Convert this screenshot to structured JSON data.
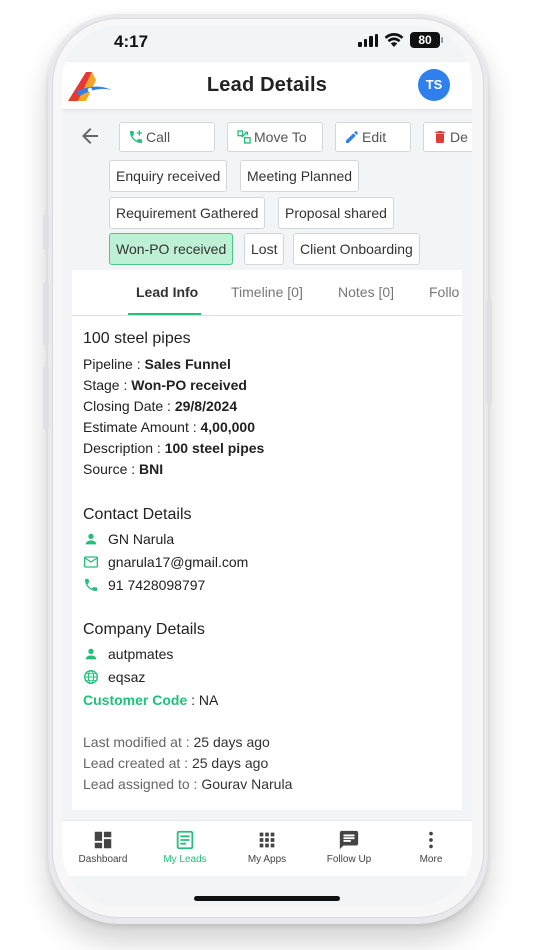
{
  "status_bar": {
    "time": "4:17",
    "battery": "80"
  },
  "app_bar": {
    "title": "Lead Details",
    "avatar_initials": "TS"
  },
  "actions": {
    "call": "Call",
    "move_to": "Move To",
    "edit": "Edit",
    "delete": "De"
  },
  "stages": {
    "enquiry": "Enquiry received",
    "meeting": "Meeting Planned",
    "requirement": "Requirement Gathered",
    "proposal": "Proposal shared",
    "won": "Won-PO received",
    "lost": "Lost",
    "onboarding": "Client Onboarding",
    "active": "Won-PO received"
  },
  "tabs": {
    "lead_info": "Lead Info",
    "timeline": "Timeline [0]",
    "notes": "Notes [0]",
    "follow": "Follo"
  },
  "lead": {
    "title": "100 steel pipes",
    "pipeline_label": "Pipeline : ",
    "pipeline": "Sales Funnel",
    "stage_label": "Stage : ",
    "stage": "Won-PO received",
    "closing_label": "Closing Date : ",
    "closing": "29/8/2024",
    "estimate_label": "Estimate Amount : ",
    "estimate": "4,00,000",
    "description_label": "Description : ",
    "description": "100 steel pipes",
    "source_label": "Source : ",
    "source": "BNI"
  },
  "contact": {
    "heading": "Contact Details",
    "name": "GN Narula",
    "email": "gnarula17@gmail.com",
    "phone": "91 7428098797"
  },
  "company": {
    "heading": "Company Details",
    "name": "autpmates",
    "website": "eqsaz",
    "customer_code_label": "Customer Code",
    "customer_code_sep": " : ",
    "customer_code": "NA"
  },
  "meta": {
    "modified_label": "Last modified at : ",
    "modified": "25 days ago",
    "created_label": "Lead created at : ",
    "created": "25 days ago",
    "assigned_label": "Lead assigned to : ",
    "assigned": "Gourav Narula"
  },
  "bottom_nav": {
    "dashboard": "Dashboard",
    "my_leads": "My Leads",
    "my_apps": "My Apps",
    "follow_up": "Follow Up",
    "more": "More"
  },
  "colors": {
    "accent": "#22c07a",
    "avatar": "#2f80ed",
    "active_chip": "#bdf0d4",
    "delete": "#e53935"
  }
}
